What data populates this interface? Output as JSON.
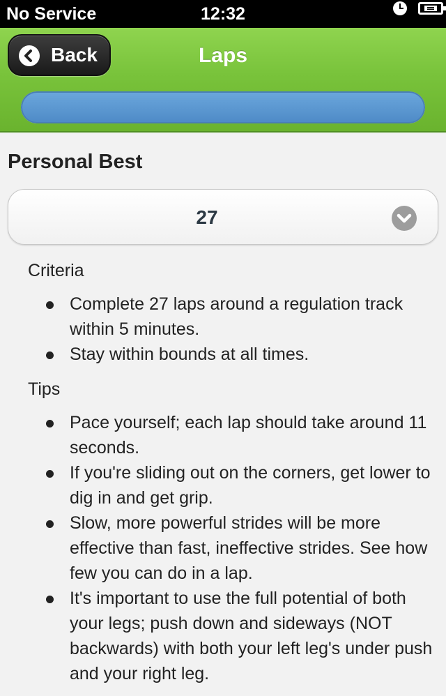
{
  "status_bar": {
    "carrier": "No Service",
    "time": "12:32",
    "icons": [
      "clock-icon",
      "battery-charging-icon"
    ]
  },
  "header": {
    "back_label": "Back",
    "title": "Laps",
    "progress": 1.0,
    "accent_color": "#7cc641",
    "progress_color": "#5a97d3"
  },
  "personal_best": {
    "heading": "Personal Best",
    "selected_value": "27"
  },
  "criteria": {
    "label": "Criteria",
    "items": [
      "Complete 27 laps around a regulation track within 5 minutes.",
      "Stay within bounds at all times."
    ]
  },
  "tips": {
    "label": "Tips",
    "items": [
      "Pace yourself; each lap should take around 11 seconds.",
      "If you're sliding out on the corners, get lower to dig in and get grip.",
      "Slow, more powerful strides will be more effective than fast, ineffective strides. See how few you can do in a lap.",
      "It's important to use the full potential of both your legs; push down and sideways (NOT backwards) with both your left leg's under push and your right leg."
    ]
  }
}
